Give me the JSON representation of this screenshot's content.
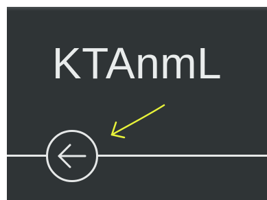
{
  "app": {
    "title": "KTAnmL"
  },
  "navigation": {
    "back_button_icon": "arrow-left-icon"
  },
  "annotation": {
    "arrow_color": "#e8f23a"
  },
  "colors": {
    "background": "#2f3436",
    "foreground": "#e6e8e8"
  }
}
